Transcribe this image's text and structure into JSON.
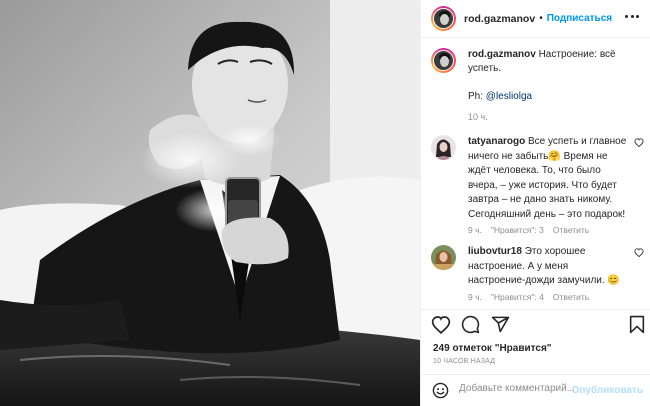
{
  "post": {
    "photo_alt": "",
    "author": "rod.gazmanov",
    "separator": "•",
    "follow_label": "Подписаться"
  },
  "caption": {
    "username": "rod.gazmanov",
    "text": "Настроение: всё успеть.",
    "credit_prefix": "Ph: ",
    "credit_link": "@lesliolga",
    "time": "10 ч."
  },
  "comments": [
    {
      "username": "tatyanarogo",
      "text": "Все успеть и главное ничего не забыть🤗 Время не ждёт человека. То, что было вчера, – уже история. Что будет завтра – не дано знать никому. Сегодняшний день – это подарок!",
      "time": "9 ч.",
      "likes": "\"Нравится\": 3",
      "reply": "Ответить"
    },
    {
      "username": "liubovtur18",
      "text": "Это хорошее настроение. А у меня настроение-дожди замучили. 😊",
      "time": "9 ч.",
      "likes": "\"Нравится\": 4",
      "reply": "Ответить"
    }
  ],
  "stats": {
    "likes": "249 отметок \"Нравится\"",
    "ago": "10 ЧАСОВ НАЗАД"
  },
  "comment_box": {
    "placeholder": "Добавьте комментарий...",
    "publish_label": "Опубликовать"
  },
  "icons": {
    "like": "heart-icon",
    "comment": "comment-icon",
    "share": "paper-plane-icon",
    "save": "bookmark-icon",
    "more": "more-dots-icon",
    "emoji": "smiley-icon"
  },
  "colors": {
    "accent": "#0095f6",
    "link": "#00376b",
    "muted": "#8e8e8e",
    "publish_disabled": "#b2dffc"
  }
}
